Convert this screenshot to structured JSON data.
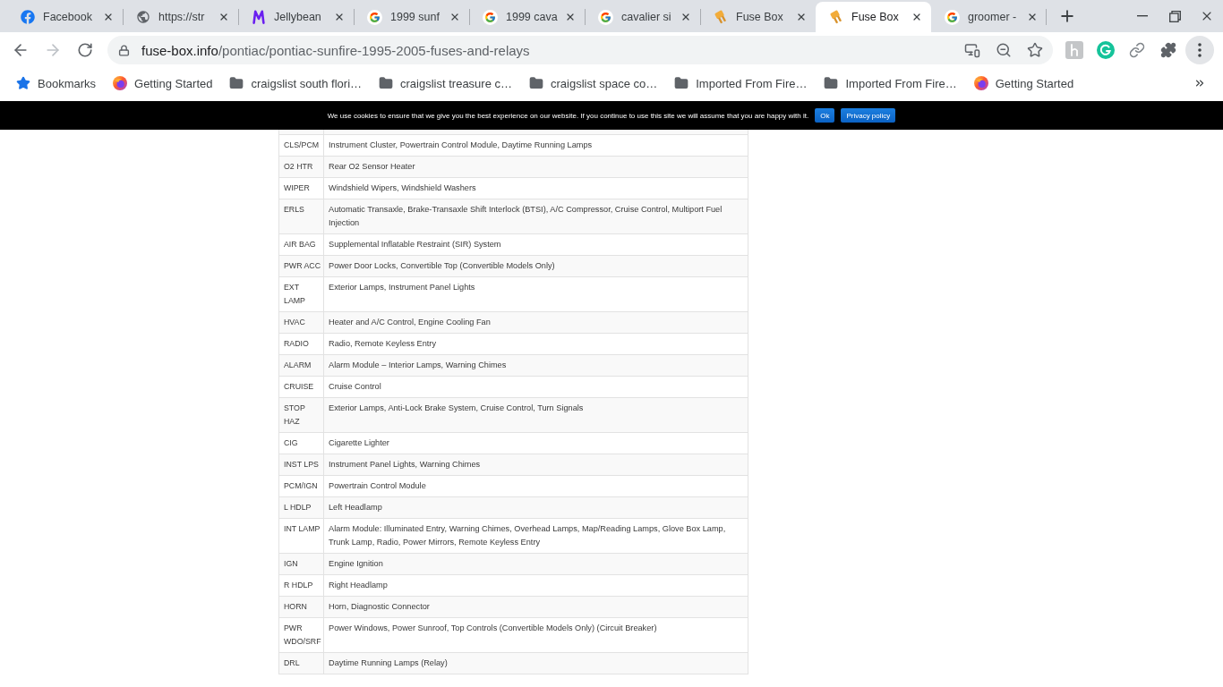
{
  "tabs": [
    {
      "kind": "facebook",
      "title": "Facebook",
      "selected": false
    },
    {
      "kind": "globe",
      "title": "https://str",
      "selected": false
    },
    {
      "kind": "monogram",
      "title": "Jellybean",
      "selected": false
    },
    {
      "kind": "google",
      "title": "1999 sunf",
      "selected": false
    },
    {
      "kind": "google",
      "title": "1999 cava",
      "selected": false
    },
    {
      "kind": "google",
      "title": "cavalier si",
      "selected": false
    },
    {
      "kind": "fuse",
      "title": "Fuse Box",
      "selected": false
    },
    {
      "kind": "fuse",
      "title": "Fuse Box",
      "selected": true
    },
    {
      "kind": "google",
      "title": "groomer -",
      "selected": false
    }
  ],
  "toolbar": {
    "nav": [
      {
        "kind": "back",
        "disabled": false
      },
      {
        "kind": "forward",
        "disabled": true
      },
      {
        "kind": "reload",
        "disabled": false
      }
    ],
    "url": {
      "host": "fuse-box.info",
      "path": "/pontiac/pontiac-sunfire-1995-2005-fuses-and-relays"
    }
  },
  "bookmarks": [
    {
      "kind": "star",
      "label": "Bookmarks"
    },
    {
      "kind": "firefox",
      "label": "Getting Started"
    },
    {
      "kind": "folder",
      "label": "craigslist south flori…"
    },
    {
      "kind": "folder",
      "label": "craigslist treasure c…"
    },
    {
      "kind": "folder",
      "label": "craigslist space co…"
    },
    {
      "kind": "folder",
      "label": "Imported From Fire…"
    },
    {
      "kind": "folder",
      "label": "Imported From Fire…"
    },
    {
      "kind": "firefox",
      "label": "Getting Started"
    }
  ],
  "cookie_notice": {
    "text": "We use cookies to ensure that we give you the best experience on our website. If you continue to use this site we will assume that you are happy with it.",
    "buttons": [
      "Ok",
      "Privacy policy"
    ]
  },
  "fuse_table": {
    "rows": [
      [
        "CLS/PCM",
        "Instrument Cluster, Powertrain Control Module, Daytime Running Lamps"
      ],
      [
        "O2 HTR",
        "Rear O2 Sensor Heater"
      ],
      [
        "WIPER",
        "Windshield Wipers, Windshield Washers"
      ],
      [
        "ERLS",
        "Automatic Transaxle, Brake-Transaxle Shift Interlock (BTSI), A/C Compressor, Cruise Control, Multiport Fuel Injection"
      ],
      [
        "AIR BAG",
        "Supplemental Inflatable Restraint (SIR) System"
      ],
      [
        "PWR ACC",
        "Power Door Locks, Convertible Top (Convertible Models Only)"
      ],
      [
        "EXT LAMP",
        "Exterior Lamps, Instrument Panel Lights"
      ],
      [
        "HVAC",
        "Heater and A/C Control, Engine Cooling Fan"
      ],
      [
        "RADIO",
        "Radio, Remote Keyless Entry"
      ],
      [
        "ALARM",
        "Alarm Module – Interior Lamps, Warning Chimes"
      ],
      [
        "CRUISE",
        "Cruise Control"
      ],
      [
        "STOP HAZ",
        "Exterior Lamps, Anti-Lock Brake System, Cruise Control, Turn Signals"
      ],
      [
        "CIG",
        "Cigarette Lighter"
      ],
      [
        "INST LPS",
        "Instrument Panel Lights, Warning Chimes"
      ],
      [
        "PCM/IGN",
        "Powertrain Control Module"
      ],
      [
        "L HDLP",
        "Left Headlamp"
      ],
      [
        "INT LAMP",
        "Alarm Module: Illuminated Entry, Warning Chimes, Overhead Lamps, Map/Reading Lamps, Glove Box Lamp, Trunk Lamp, Radio, Power Mirrors, Remote Keyless Entry"
      ],
      [
        "IGN",
        "Engine Ignition"
      ],
      [
        "R HDLP",
        "Right Headlamp"
      ],
      [
        "HORN",
        "Horn, Diagnostic Connector"
      ],
      [
        "PWR WDO/SRF",
        "Power Windows, Power Sunroof, Top Controls (Convertible Models Only) (Circuit Breaker)"
      ],
      [
        "DRL",
        "Daytime Running Lamps (Relay)"
      ]
    ]
  }
}
